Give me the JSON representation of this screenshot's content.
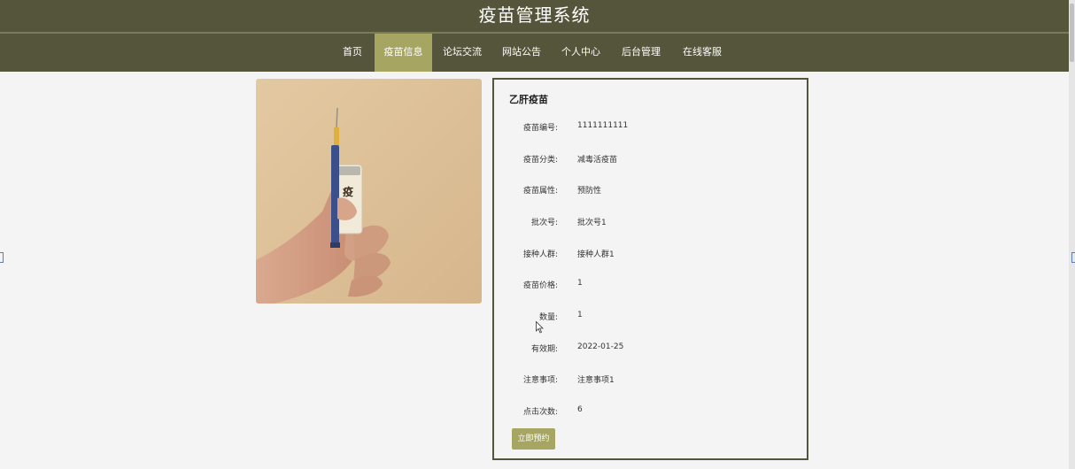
{
  "app": {
    "title": "疫苗管理系统"
  },
  "nav": {
    "items": [
      {
        "label": "首页"
      },
      {
        "label": "疫苗信息"
      },
      {
        "label": "论坛交流"
      },
      {
        "label": "网站公告"
      },
      {
        "label": "个人中心"
      },
      {
        "label": "后台管理"
      },
      {
        "label": "在线客服"
      }
    ],
    "active_index": 1
  },
  "vaccine": {
    "name": "乙肝疫苗",
    "image_label": "疫苗",
    "fields": [
      {
        "label": "疫苗编号:",
        "value": "1111111111"
      },
      {
        "label": "疫苗分类:",
        "value": "减毒活疫苗"
      },
      {
        "label": "疫苗属性:",
        "value": "预防性"
      },
      {
        "label": "批次号:",
        "value": "批次号1"
      },
      {
        "label": "接种人群:",
        "value": "接种人群1"
      },
      {
        "label": "疫苗价格:",
        "value": "1"
      },
      {
        "label": "数量:",
        "value": "1"
      },
      {
        "label": "有效期:",
        "value": "2022-01-25"
      },
      {
        "label": "注意事项:",
        "value": "注意事项1"
      },
      {
        "label": "点击次数:",
        "value": "6"
      }
    ],
    "reserve_label": "立即预约"
  },
  "colors": {
    "header_bg": "#54553a",
    "accent": "#a6a562",
    "page_bg": "#f4f4f4"
  }
}
